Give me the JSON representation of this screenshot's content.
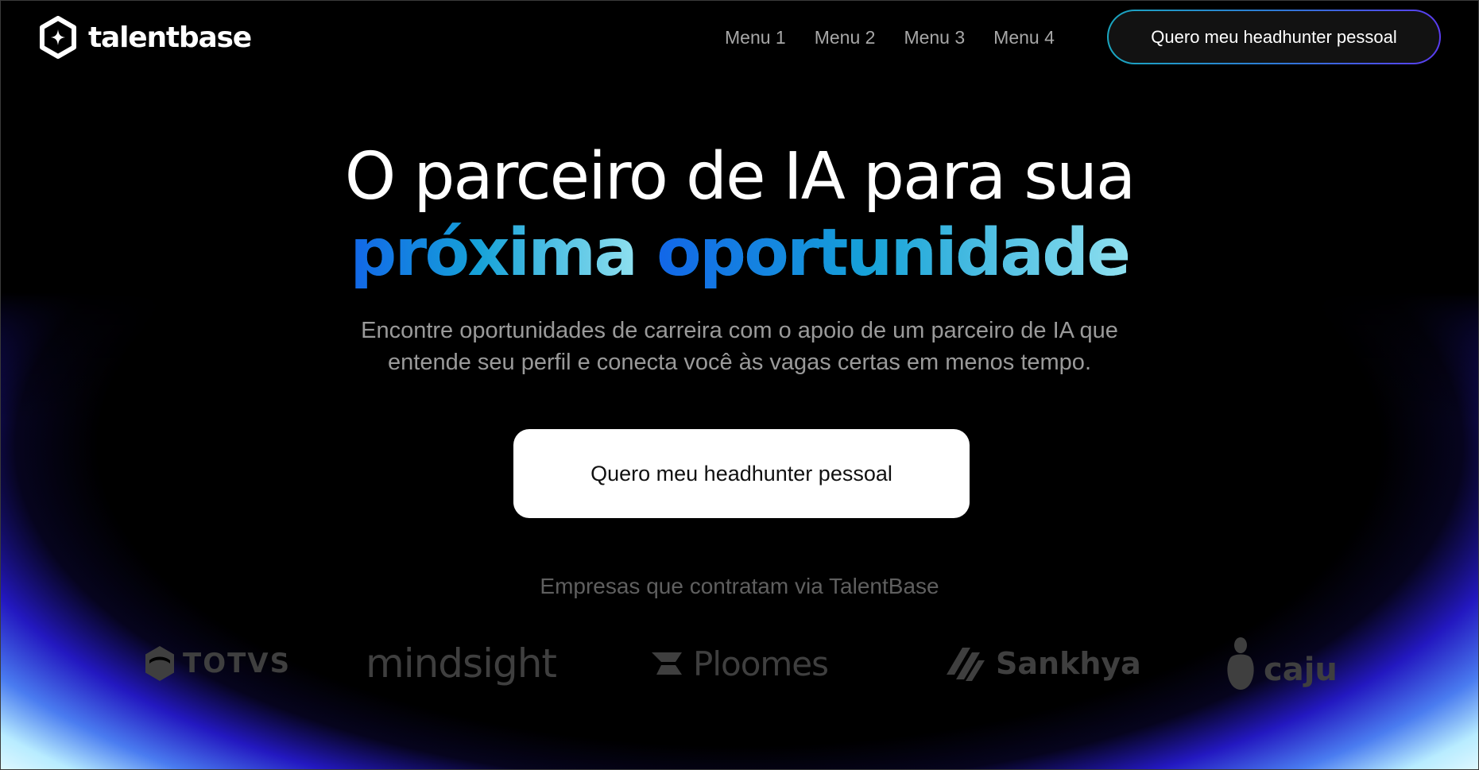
{
  "brand": {
    "name": "talentbase",
    "logo_icon": "hexagon-sparkle-icon"
  },
  "nav": {
    "items": [
      {
        "label": "Menu 1"
      },
      {
        "label": "Menu 2"
      },
      {
        "label": "Menu 3"
      },
      {
        "label": "Menu 4"
      }
    ],
    "cta_label": "Quero meu headhunter pessoal"
  },
  "hero": {
    "title_line1": "O parceiro de IA para sua",
    "title_line2_word1": "próxima",
    "title_line2_word2": "oportunidade",
    "subtitle_line1": "Encontre oportunidades de carreira com o apoio de um parceiro de IA que",
    "subtitle_line2": "entende seu perfil e conecta você às vagas certas em menos tempo.",
    "cta_label": "Quero meu headhunter pessoal"
  },
  "companies": {
    "label": "Empresas que contratam via TalentBase",
    "logos": [
      {
        "name": "TOTVS",
        "icon": "totvs-hexagon-icon"
      },
      {
        "name": "mindsight",
        "icon": "mindsight-wordmark"
      },
      {
        "name": "Ploomes",
        "icon": "ploomes-arrow-icon"
      },
      {
        "name": "Sankhya",
        "icon": "sankhya-stripes-icon"
      },
      {
        "name": "caju",
        "icon": "caju-fruit-icon"
      }
    ]
  },
  "colors": {
    "background": "#000000",
    "accent_gradient_start": "#1266e8",
    "accent_gradient_mid": "#16a2d8",
    "accent_gradient_end": "#8fe0ef",
    "glow_blue": "#2b22d6",
    "glow_light": "#c9f4ff",
    "muted_text": "#9a9a9a",
    "logo_gray": "#3f3f3f"
  }
}
